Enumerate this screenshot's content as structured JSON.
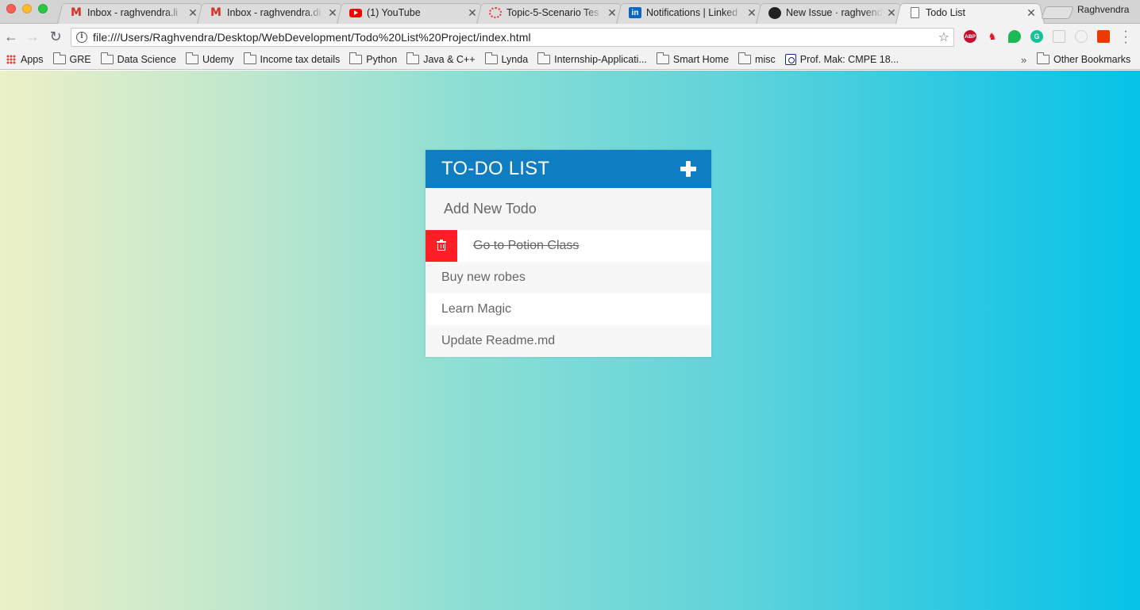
{
  "browser": {
    "tabs": [
      {
        "title": "Inbox - raghvendra.li",
        "favicon": "gmail-icon",
        "active": false
      },
      {
        "title": "Inbox - raghvendra.di",
        "favicon": "gmail-icon",
        "active": false
      },
      {
        "title": "(1) YouTube",
        "favicon": "youtube-icon",
        "active": false
      },
      {
        "title": "Topic-5-Scenario Tes",
        "favicon": "ring-icon",
        "active": false
      },
      {
        "title": "Notifications | Linked",
        "favicon": "linkedin-icon",
        "active": false
      },
      {
        "title": "New Issue · raghvendi",
        "favicon": "github-icon",
        "active": false
      },
      {
        "title": "Todo List",
        "favicon": "document-icon",
        "active": true
      }
    ],
    "profile_name": "Raghvendra",
    "url": "file:///Users/Raghvendra/Desktop/WebDevelopment/Todo%20List%20Project/index.html",
    "extensions": [
      "adblock-plus-icon",
      "red-extension-icon",
      "green-extension-icon",
      "grammarly-icon",
      "gray-extension-icon",
      "gray-circle-extension-icon",
      "office-icon"
    ],
    "bookmarks": [
      {
        "label": "Apps",
        "icon": "apps-icon"
      },
      {
        "label": "GRE",
        "icon": "folder-icon"
      },
      {
        "label": "Data Science",
        "icon": "folder-icon"
      },
      {
        "label": "Udemy",
        "icon": "folder-icon"
      },
      {
        "label": "Income tax details",
        "icon": "folder-icon"
      },
      {
        "label": "Python",
        "icon": "folder-icon"
      },
      {
        "label": "Java & C++",
        "icon": "folder-icon"
      },
      {
        "label": "Lynda",
        "icon": "folder-icon"
      },
      {
        "label": "Internship-Applicati...",
        "icon": "folder-icon"
      },
      {
        "label": "Smart Home",
        "icon": "folder-icon"
      },
      {
        "label": "misc",
        "icon": "folder-icon"
      },
      {
        "label": "Prof. Mak: CMPE 18...",
        "icon": "bookmark-favicon"
      }
    ],
    "bookmarks_overflow": "»",
    "other_bookmarks": "Other Bookmarks"
  },
  "app": {
    "title": "TO-DO LIST",
    "input_placeholder": "Add New Todo",
    "todos": [
      {
        "text": "Go to Potion Class",
        "completed": true,
        "hovered": true
      },
      {
        "text": "Buy new robes",
        "completed": false,
        "hovered": false
      },
      {
        "text": "Learn Magic",
        "completed": false,
        "hovered": false
      },
      {
        "text": "Update Readme.md",
        "completed": false,
        "hovered": false
      }
    ]
  },
  "colors": {
    "header": "#0f7dc2",
    "delete": "#ff1f25",
    "gradient_start": "#ecf0c6",
    "gradient_end": "#06c3e8"
  }
}
